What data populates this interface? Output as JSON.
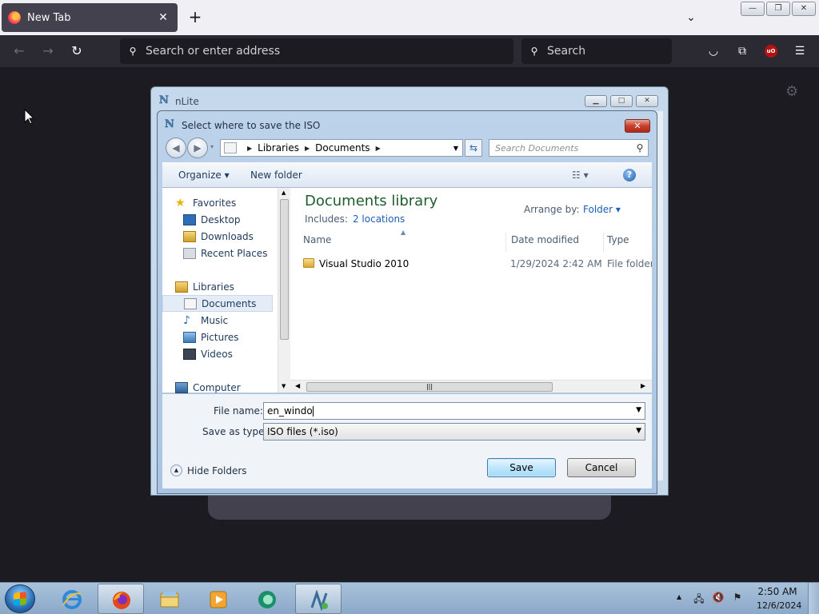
{
  "browser": {
    "tab_title": "New Tab",
    "tab_close": "✕",
    "new_tab": "+",
    "address_placeholder": "Search or enter address",
    "search_placeholder": "Search",
    "window_buttons": [
      "—",
      "❐",
      "✕"
    ]
  },
  "nlite": {
    "title": "nLite"
  },
  "dialog": {
    "title": "Select where to save the ISO",
    "breadcrumb": [
      "Libraries",
      "Documents"
    ],
    "search_placeholder": "Search Documents",
    "toolbar": {
      "organize": "Organize ▾",
      "new_folder": "New folder"
    },
    "nav": {
      "favorites": "Favorites",
      "favorites_items": [
        "Desktop",
        "Downloads",
        "Recent Places"
      ],
      "libraries": "Libraries",
      "libraries_items": [
        "Documents",
        "Music",
        "Pictures",
        "Videos"
      ],
      "computer": "Computer"
    },
    "library": {
      "title": "Documents library",
      "includes_label": "Includes:",
      "includes_link": "2 locations",
      "arrange_label": "Arrange by:",
      "arrange_value": "Folder ▾"
    },
    "columns": [
      "Name",
      "Date modified",
      "Type"
    ],
    "files": [
      {
        "name": "Visual Studio 2010",
        "modified": "1/29/2024 2:42 AM",
        "type": "File folder"
      }
    ],
    "filename_label": "File name:",
    "filename_value": "en_windo",
    "filetype_label": "Save as type:",
    "filetype_value": "ISO files (*.iso)",
    "hide_folders": "Hide Folders",
    "save_label": "Save",
    "cancel_label": "Cancel"
  },
  "taskbar": {
    "time": "2:50 AM",
    "date": "12/6/2024"
  }
}
